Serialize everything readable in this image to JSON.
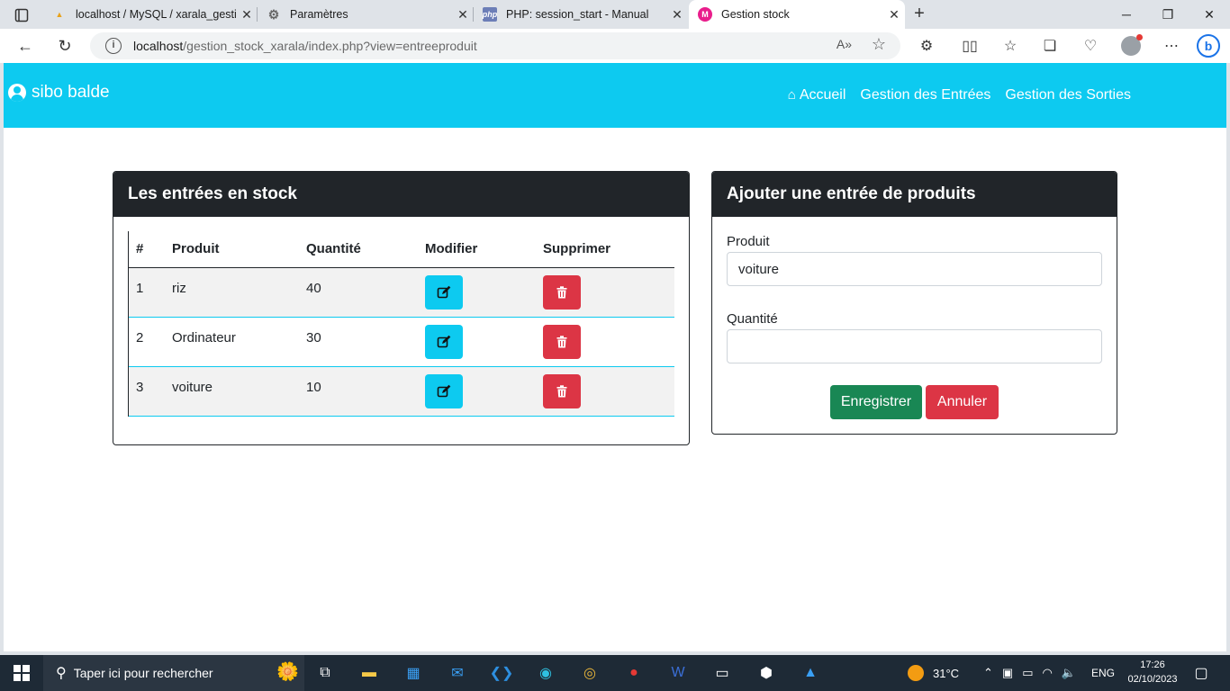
{
  "browser": {
    "tabs": [
      {
        "title": "localhost / MySQL / xarala_gestic",
        "favicon": "pma"
      },
      {
        "title": "Paramètres",
        "favicon": "gear"
      },
      {
        "title": "PHP: session_start - Manual",
        "favicon": "php"
      },
      {
        "title": "Gestion stock",
        "favicon": "app"
      }
    ],
    "url_host": "localhost",
    "url_path": "/gestion_stock_xarala/index.php?view=entreeproduit"
  },
  "app": {
    "brand": "sibo balde",
    "nav": {
      "home": "Accueil",
      "entrees": "Gestion des Entrées",
      "sorties": "Gestion des Sorties"
    }
  },
  "stock": {
    "title": "Les entrées en stock",
    "headers": [
      "#",
      "Produit",
      "Quantité",
      "Modifier",
      "Supprimer"
    ],
    "rows": [
      {
        "id": "1",
        "produit": "riz",
        "quantite": "40"
      },
      {
        "id": "2",
        "produit": "Ordinateur",
        "quantite": "30"
      },
      {
        "id": "3",
        "produit": "voiture",
        "quantite": "10"
      }
    ]
  },
  "form": {
    "title": "Ajouter une entrée de produits",
    "produit_label": "Produit",
    "produit_value": "voiture",
    "quantite_label": "Quantité",
    "quantite_value": "",
    "save": "Enregistrer",
    "cancel": "Annuler"
  },
  "taskbar": {
    "search_placeholder": "Taper ici pour rechercher",
    "weather": "31°C",
    "lang": "ENG",
    "time": "17:26",
    "date": "02/10/2023"
  },
  "colors": {
    "accent": "#0dcaf0",
    "dark": "#212529",
    "danger": "#dc3545",
    "success": "#198754"
  }
}
